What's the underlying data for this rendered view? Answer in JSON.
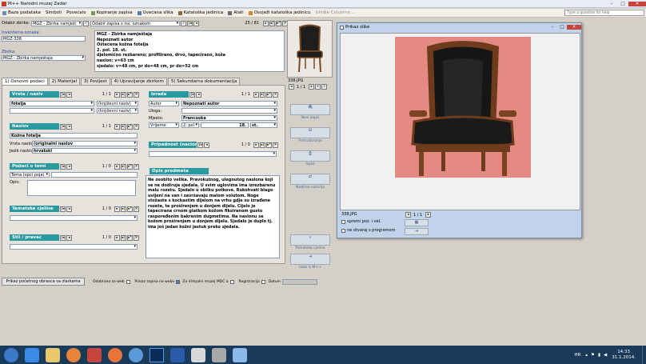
{
  "window": {
    "title": "M++ Narodni muzej Zadar"
  },
  "toolbar": {
    "items": [
      "Baza podataka",
      "Simboli",
      "Povećalo",
      "Kopiranje zapisa",
      "Uvećana slika",
      "Kataloška jedinica",
      "Alati",
      "Osvježi kataloška jedinicu",
      "Unidie Columns..."
    ],
    "help_placeholder": "Type a question for help"
  },
  "filterbar": {
    "odabir_label": "Odabir zbirke:",
    "odabir_value": "MGZ - Zbirka namješt",
    "zapis_value": "Odabir zapisa s inv. oznakom",
    "counter": "25 / 81"
  },
  "header": {
    "inv_label": "Inventarna oznaka:",
    "inv_value": "MGZ-338",
    "zbirka_label": "Zbirka:",
    "zbirka_value": "MGZ - Zbirka namještaja",
    "summary": [
      "MGZ - Zbirka namještaja",
      "Nepoznati autor",
      "Oštećena kožna fotelja",
      "2. pol. 18. st.",
      "djelomično rezbareno; profilirano, drvo, tapecirano, koža",
      "naslon: v=63 cm",
      "sjedalo: v=48 cm, pr do=48 cm, pr do=52 cm"
    ]
  },
  "tabs": [
    "1) Osnovni podaci",
    "2) Materijal",
    "3) Povijest",
    "4) Upravljanje zbirkom",
    "5) Sekundarna dokumentacija"
  ],
  "vrsta": {
    "title": "Vrsta / naziv",
    "count": "1 / 1",
    "value": "fotelja",
    "opt1": "(književni naziv)",
    "opt2": "(književni naziv)"
  },
  "naslov": {
    "title": "Naslov",
    "count": "1 / 1",
    "value": "Kožna fotelja",
    "vrsta_label": "Vrsta naslova:",
    "vrsta_value": "(originalni naslov",
    "jezik_label": "Jezik naslova:",
    "jezik_value": "hrvatski"
  },
  "podaci": {
    "title": "Podaci o temi",
    "count": "1 / 0",
    "tema_label": "Tema (opći poja)",
    "opis_label": "Opis:"
  },
  "tematske": {
    "title": "Tematske cjeline",
    "count": "1 / 0"
  },
  "stil": {
    "title": "Stil / pravac",
    "count": "1 / 0"
  },
  "izrada": {
    "title": "Izrada",
    "count": "1 / 1",
    "autor_label": "Autor",
    "autor_value": "Nepoznati autor",
    "uloga_label": "Uloga:",
    "mjesto_label": "Mjesto:",
    "mjesto_value": "Francuska",
    "vrijeme_label": "Vrijeme:",
    "vrijeme_a": "2. pol",
    "vrijeme_b": "18.",
    "vrijeme_c": "st."
  },
  "pripadnost": {
    "title": "Pripadnost (nacionalna",
    "count": "1 / 0"
  },
  "opis": {
    "title": "Opis predmeta",
    "text": "Ne osobito velika. Pravokutnog, ulegnutog naslona koji se ne dodiruje sjedala. U svim uglovima ima izrezbarenu malu rozetu. Sjedalo u obliku potkove. Rukohvati blago uvijeni na van i završavaju malom volutom. Noge stožaste s kockastim dijelom na vrhu gdje su izrađene rozete, te proširenjem u donjem dijelu. Cijelo je tapecirana crnom glatkom kožom fiksiranom gusto raspoređenim bakrenim dugmetima. Na naslonu se kožom proširenjem u donjem dijelu. Sjedalo je duplo tj. ima još jedan kožni jastuk preko sjedala."
  },
  "image_strip": {
    "filename": "338.JPG",
    "counter": "1 / 1"
  },
  "side_buttons": [
    {
      "icon": "new-record-icon",
      "label": "Novi zapis"
    },
    {
      "icon": "binoculars-icon",
      "label": "Pretraživanje"
    },
    {
      "icon": "printer-icon",
      "label": "Ispisi"
    },
    {
      "icon": "replace-icon",
      "label": "Nađi/ne nazivlja"
    },
    {
      "icon": "search-icon",
      "label": "Tematske cjeline"
    },
    {
      "icon": "exit-icon",
      "label": "Izlaz iz M++"
    }
  ],
  "bottombar": {
    "print_label": "Prikaz početnog obrasca sa zlarkama",
    "c1": "Odabrano za web",
    "c2": "Prikaz zapisa na webu",
    "c3": "Za Virtualni muzej MDC a",
    "c4": "Registracija",
    "c5": "Datum"
  },
  "viewer": {
    "title": "Prikaz slike",
    "filename": "338.JPG",
    "counter": "1 / 1",
    "opt1": "spremi poz. i vel.",
    "opt2": "ne otvaraj s programom"
  },
  "taskbar": {
    "lang": "HR",
    "time": "14:33",
    "date": "31.1.2014."
  },
  "colors": {
    "section": "#2a9aa0",
    "titlebar": "#c1d3ea",
    "taskbar": "#1a3a5a"
  }
}
